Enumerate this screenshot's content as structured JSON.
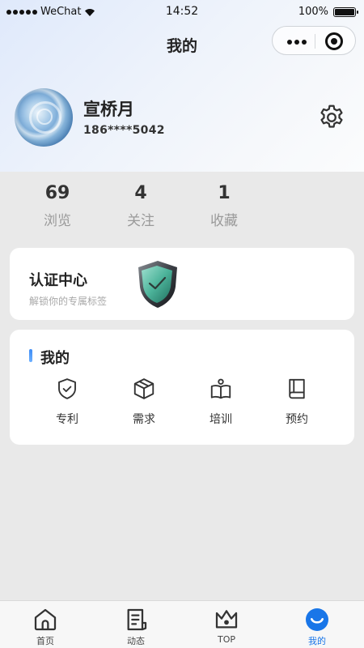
{
  "statusbar": {
    "carrier": "WeChat",
    "time": "14:52",
    "battery": "100%"
  },
  "navbar": {
    "title": "我的",
    "more_icon": "more-dots-icon",
    "close_icon": "target-close-icon"
  },
  "profile": {
    "name": "宣桥月",
    "phone": "186****5042",
    "settings_icon": "gear-icon"
  },
  "stats": [
    {
      "value": "69",
      "label": "浏览"
    },
    {
      "value": "4",
      "label": "关注"
    },
    {
      "value": "1",
      "label": "收藏"
    }
  ],
  "certification": {
    "title": "认证中心",
    "subtitle": "解锁你的专属标签",
    "icon": "shield-check-icon"
  },
  "mine": {
    "title": "我的",
    "items": [
      {
        "label": "专利",
        "icon": "shield-check-icon"
      },
      {
        "label": "需求",
        "icon": "cube-icon"
      },
      {
        "label": "培训",
        "icon": "book-open-icon"
      },
      {
        "label": "预约",
        "icon": "book-icon"
      }
    ]
  },
  "tabbar": {
    "items": [
      {
        "label": "首页",
        "icon": "home-icon"
      },
      {
        "label": "动态",
        "icon": "document-icon"
      },
      {
        "label": "TOP",
        "icon": "crown-icon"
      },
      {
        "label": "我的",
        "icon": "smile-icon",
        "active": true
      }
    ],
    "accent": "#1976e8"
  }
}
